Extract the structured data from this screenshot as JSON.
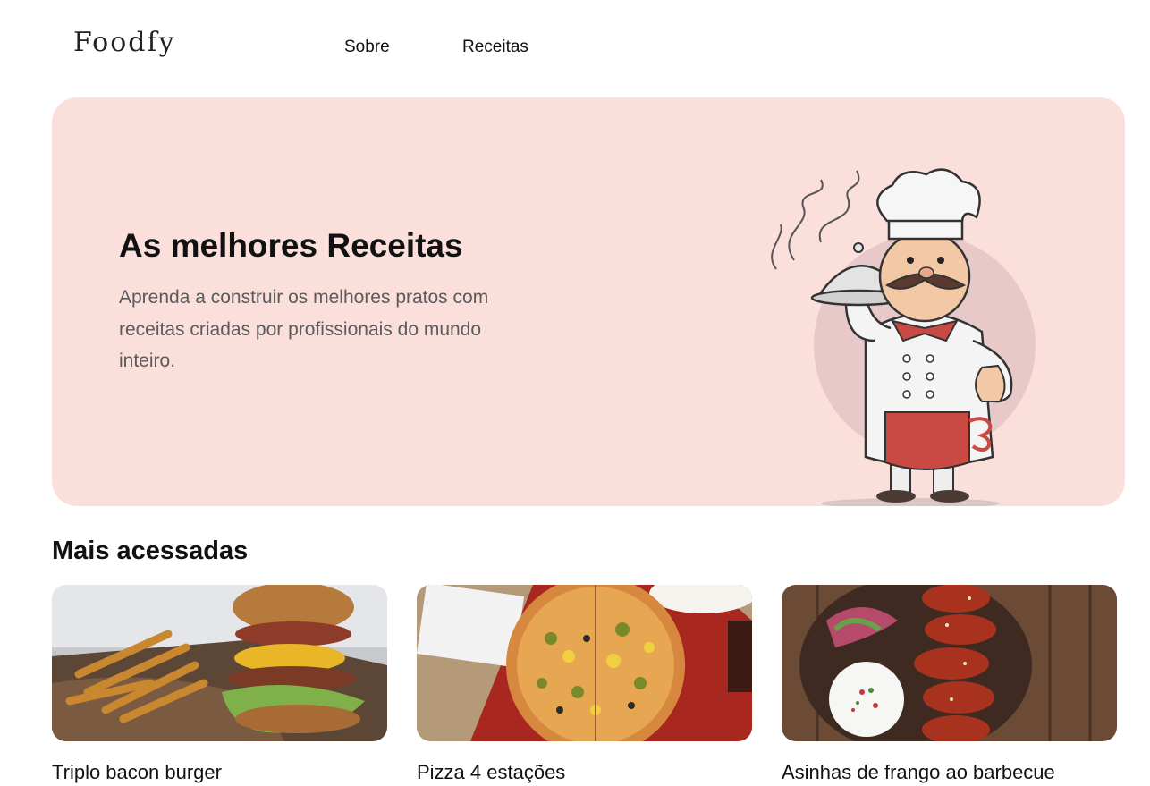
{
  "header": {
    "logo": "Foodfy",
    "nav": [
      {
        "label": "Sobre"
      },
      {
        "label": "Receitas"
      }
    ]
  },
  "hero": {
    "title": "As melhores Receitas",
    "subtitle": "Aprenda a construir os melhores pratos com receitas criadas por profissionais do mundo inteiro.",
    "background": "#fbdfdb",
    "illustration": "chef-illustration"
  },
  "featured": {
    "heading": "Mais acessadas",
    "recipes": [
      {
        "title": "Triplo bacon burger",
        "image": "burger-photo"
      },
      {
        "title": "Pizza 4 estações",
        "image": "pizza-photo"
      },
      {
        "title": "Asinhas de frango ao barbecue",
        "image": "chicken-wings-photo"
      }
    ]
  }
}
